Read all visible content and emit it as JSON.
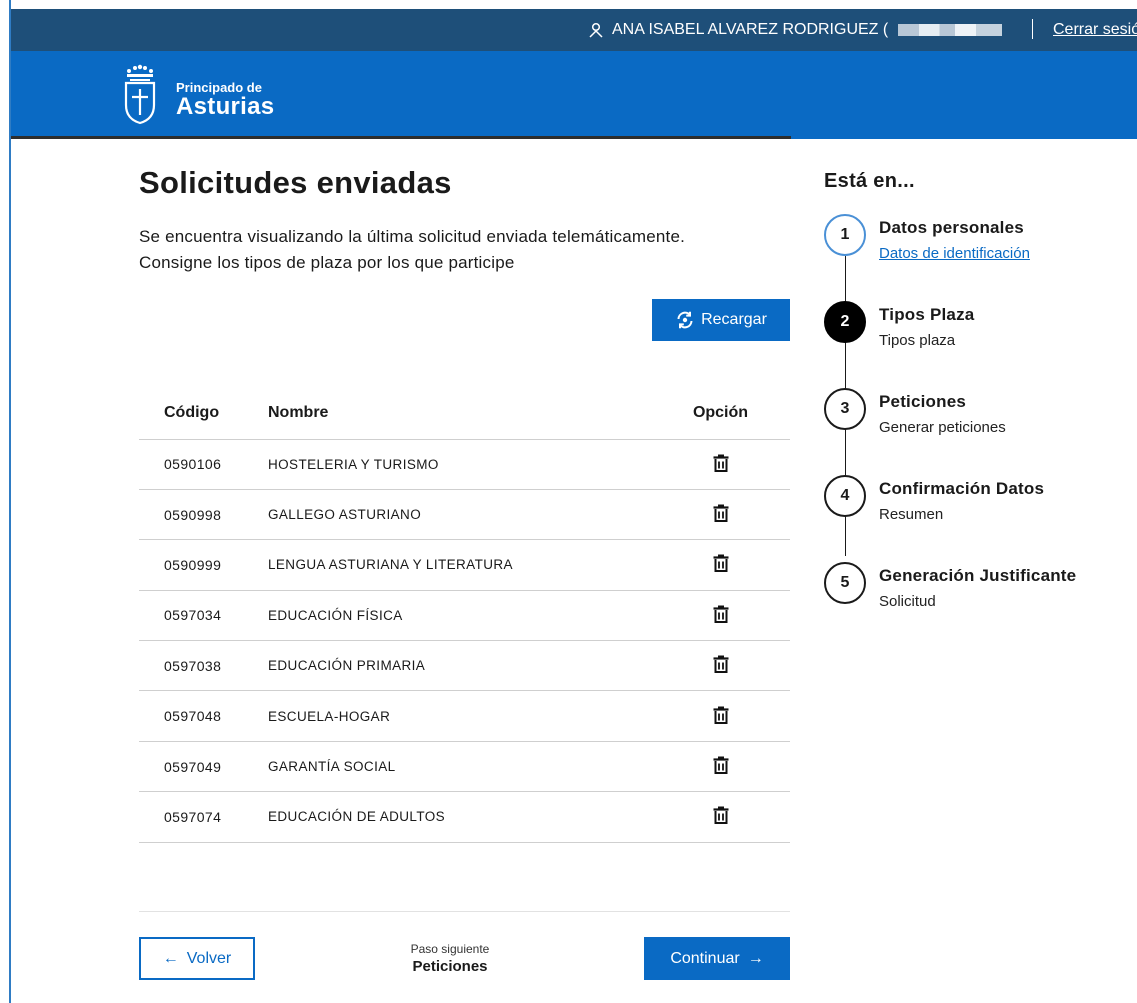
{
  "user_bar": {
    "user_name": "ANA ISABEL ALVAREZ RODRIGUEZ (",
    "logout_label": "Cerrar sesió"
  },
  "brand": {
    "line1": "Principado de",
    "line2": "Asturias"
  },
  "page": {
    "title": "Solicitudes enviadas",
    "intro_line1": "Se encuentra visualizando la última solicitud enviada telemáticamente.",
    "intro_line2": "Consigne los tipos de plaza por los que participe"
  },
  "reload_label": "Recargar",
  "table": {
    "headers": {
      "code": "Código",
      "name": "Nombre",
      "option": "Opción"
    },
    "rows": [
      {
        "code": "0590106",
        "name": "HOSTELERIA Y TURISMO"
      },
      {
        "code": "0590998",
        "name": "GALLEGO ASTURIANO"
      },
      {
        "code": "0590999",
        "name": "LENGUA ASTURIANA Y LITERATURA"
      },
      {
        "code": "0597034",
        "name": "EDUCACIÓN FÍSICA"
      },
      {
        "code": "0597038",
        "name": "EDUCACIÓN PRIMARIA"
      },
      {
        "code": "0597048",
        "name": "ESCUELA-HOGAR"
      },
      {
        "code": "0597049",
        "name": "GARANTÍA SOCIAL"
      },
      {
        "code": "0597074",
        "name": "EDUCACIÓN DE ADULTOS"
      }
    ]
  },
  "footer": {
    "back_label": "Volver",
    "next_step_label": "Paso siguiente",
    "next_step_value": "Peticiones",
    "continue_label": "Continuar"
  },
  "stepper": {
    "title": "Está en...",
    "steps": [
      {
        "number": "1",
        "title": "Datos personales",
        "subtitle": "Datos de identificación"
      },
      {
        "number": "2",
        "title": "Tipos Plaza",
        "subtitle": "Tipos plaza"
      },
      {
        "number": "3",
        "title": "Peticiones",
        "subtitle": "Generar peticiones"
      },
      {
        "number": "4",
        "title": "Confirmación Datos",
        "subtitle": "Resumen"
      },
      {
        "number": "5",
        "title": "Generación Justificante",
        "subtitle": "Solicitud"
      }
    ]
  },
  "colors": {
    "user_bar_bg": "#1e4f79",
    "brand_bg": "#0a6ac4",
    "accent": "#0a6ac4",
    "current_step": "#000000"
  },
  "icons": [
    "user-icon",
    "crest-logo",
    "reload-icon",
    "trash-icon",
    "arrow-left-icon",
    "arrow-right-icon"
  ]
}
